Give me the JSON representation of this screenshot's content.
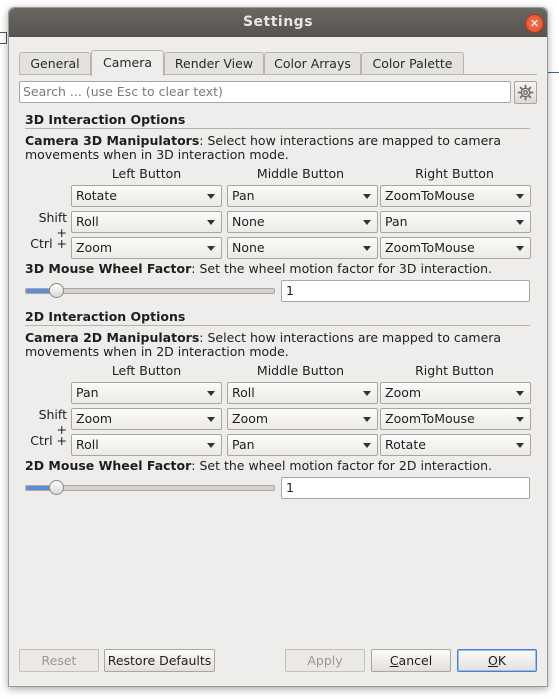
{
  "window": {
    "title": "Settings",
    "close_icon": "close-icon"
  },
  "tabs": [
    {
      "label": "General",
      "active": false
    },
    {
      "label": "Camera",
      "active": true
    },
    {
      "label": "Render View",
      "active": false
    },
    {
      "label": "Color Arrays",
      "active": false
    },
    {
      "label": "Color Palette",
      "active": false
    }
  ],
  "search": {
    "placeholder": "Search ... (use Esc to clear text)",
    "value": "",
    "advanced_icon": "gear-icon"
  },
  "section3d": {
    "title": "3D Interaction Options",
    "manip_bold": "Camera 3D Manipulators",
    "manip_desc": ": Select how interactions are mapped to camera movements when in 3D interaction mode.",
    "columns": [
      "Left Button",
      "Middle Button",
      "Right Button"
    ],
    "rows": [
      {
        "label": "",
        "values": [
          "Rotate",
          "Pan",
          "ZoomToMouse"
        ]
      },
      {
        "label": "Shift +",
        "values": [
          "Roll",
          "None",
          "Pan"
        ]
      },
      {
        "label": "Ctrl +",
        "values": [
          "Zoom",
          "None",
          "ZoomToMouse"
        ]
      }
    ],
    "wheel_bold": "3D Mouse Wheel Factor",
    "wheel_desc": ": Set the wheel motion factor for 3D interaction.",
    "wheel_value": "1",
    "wheel_slider_fraction": 0.12
  },
  "section2d": {
    "title": "2D Interaction Options",
    "manip_bold": "Camera 2D Manipulators",
    "manip_desc": ": Select how interactions are mapped to camera movements when in 2D interaction mode.",
    "columns": [
      "Left Button",
      "Middle Button",
      "Right Button"
    ],
    "rows": [
      {
        "label": "",
        "values": [
          "Pan",
          "Roll",
          "Zoom"
        ]
      },
      {
        "label": "Shift +",
        "values": [
          "Zoom",
          "Zoom",
          "ZoomToMouse"
        ]
      },
      {
        "label": "Ctrl +",
        "values": [
          "Roll",
          "Pan",
          "Rotate"
        ]
      }
    ],
    "wheel_bold": "2D Mouse Wheel Factor",
    "wheel_desc": ": Set the wheel motion factor for 2D interaction.",
    "wheel_value": "1",
    "wheel_slider_fraction": 0.12
  },
  "buttons": {
    "reset": "Reset",
    "restore": "Restore Defaults",
    "apply": "Apply",
    "cancel_first": "C",
    "cancel_rest": "ancel",
    "ok_first": "O",
    "ok_rest": "K"
  },
  "colors": {
    "accent": "#5a8fd6",
    "close": "#df4a23",
    "window_bg": "#efedeb"
  }
}
